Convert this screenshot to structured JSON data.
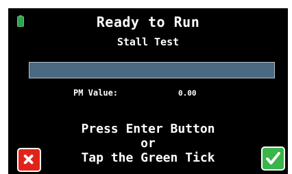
{
  "status": {
    "title": "Ready to Run",
    "test_name": "Stall Test"
  },
  "battery": {
    "icon": "battery-icon",
    "color": "#2ea44f"
  },
  "progress": {
    "fraction": 0.0,
    "track_color": "#4a6a83",
    "fill_color": "#2ea44f"
  },
  "pm": {
    "label": "PM Value:",
    "value": "0.00"
  },
  "instructions": {
    "line1": "Press Enter Button",
    "line2": "or",
    "line3": "Tap the Green Tick"
  },
  "buttons": {
    "cancel": {
      "icon": "cross-icon",
      "color": "#e2231a"
    },
    "confirm": {
      "icon": "check-icon",
      "color": "#39b54a"
    }
  }
}
